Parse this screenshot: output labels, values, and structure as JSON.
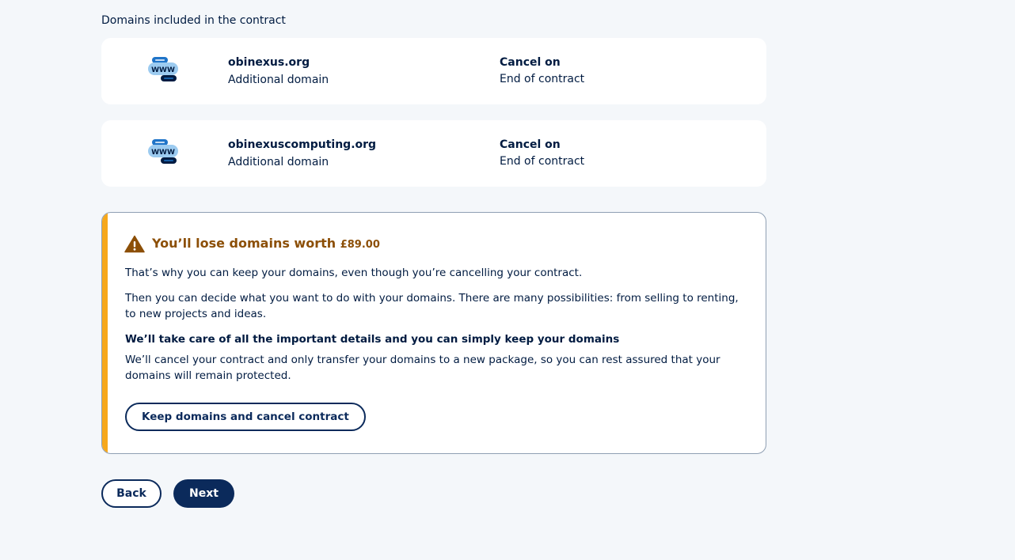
{
  "section": {
    "label": "Domains included in the contract"
  },
  "domains": [
    {
      "name": "obinexus.org",
      "type": "Additional domain",
      "cancel_label": "Cancel on",
      "cancel_value": "End of contract",
      "icon": "www-domain-icon",
      "icon_text": "WWW"
    },
    {
      "name": "obinexuscomputing.org",
      "type": "Additional domain",
      "cancel_label": "Cancel on",
      "cancel_value": "End of contract",
      "icon": "www-domain-icon",
      "icon_text": "WWW"
    }
  ],
  "warning": {
    "icon": "warning-triangle-icon",
    "title": "You’ll lose domains worth",
    "amount": "£89.00",
    "paragraph1": "That’s why you can keep your domains, even though you’re cancelling your contract.",
    "paragraph2": "Then you can decide what you want to do with your domains. There are many possibilities: from selling to renting, to new projects and ideas.",
    "heading": "We’ll take care of all the important details and you can simply keep your domains",
    "paragraph3": "We’ll cancel your contract and only transfer your domains to a new package, so you can rest assured that your domains will remain protected.",
    "button_label": "Keep domains and cancel contract"
  },
  "navigation": {
    "back_label": "Back",
    "next_label": "Next"
  },
  "colors": {
    "background": "#f4f7fa",
    "text": "#001b41",
    "primary": "#0b2a5b",
    "warning_accent": "#f6a81c",
    "warning_title": "#8c4f07",
    "icon_light": "#9ccbf0",
    "icon_mid": "#1f74c8",
    "icon_dark": "#001b41"
  }
}
